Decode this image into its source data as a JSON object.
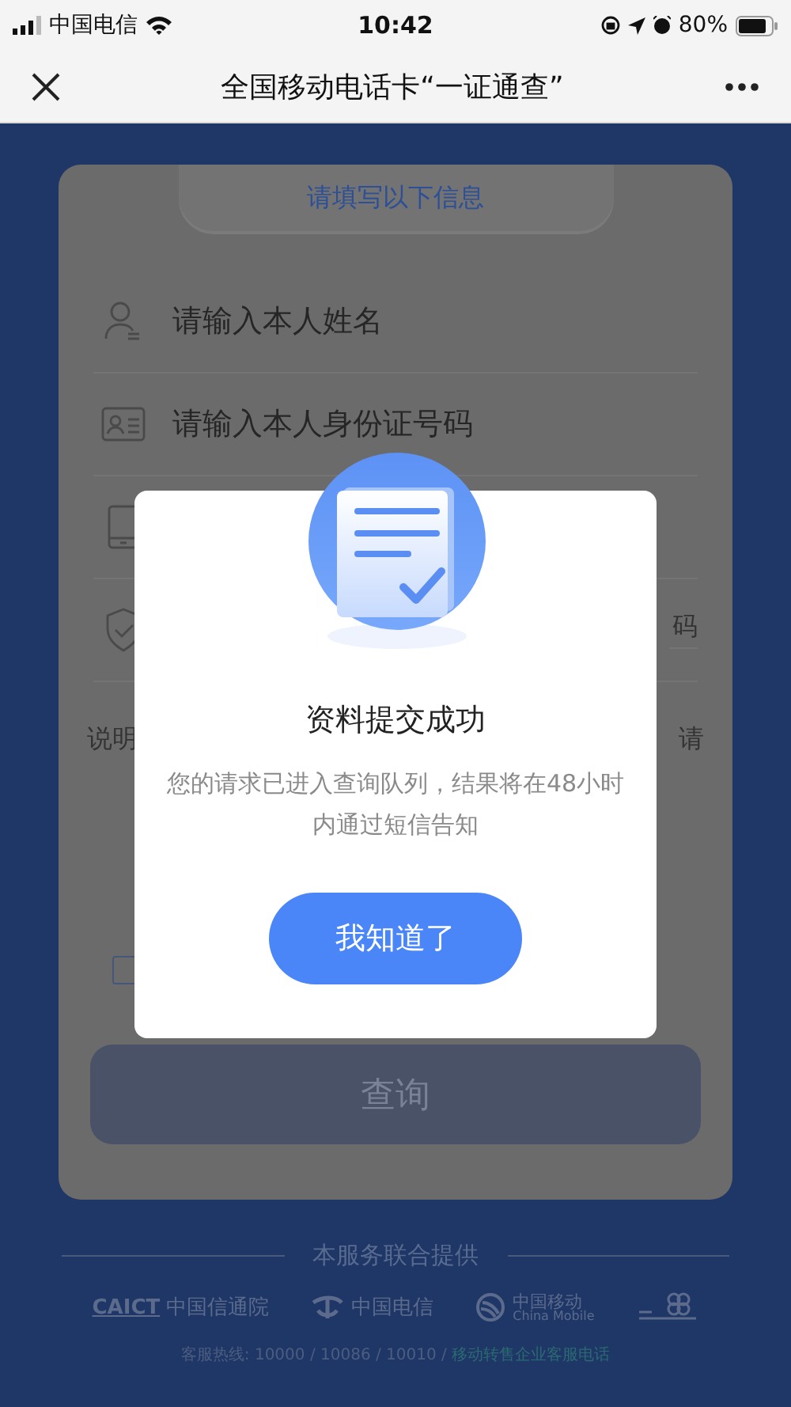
{
  "status_bar": {
    "carrier": "中国电信",
    "time": "10:42",
    "battery": "80%"
  },
  "nav": {
    "title": "全国移动电话卡“一证通查”"
  },
  "form": {
    "header": "请填写以下信息",
    "fields": [
      {
        "kind": "person",
        "placeholder": "请输入本人姓名"
      },
      {
        "kind": "id-card",
        "placeholder": "请输入本人身份证号码"
      },
      {
        "kind": "phone"
      },
      {
        "kind": "shield",
        "text": "码"
      }
    ],
    "note": {
      "left": "说明",
      "right": "请"
    },
    "agree_checked": false,
    "query_button": "查询"
  },
  "footer": {
    "heading": "本服务联合提供",
    "partners": [
      {
        "kind": "caict",
        "name": "CAICT",
        "label": "中国信通院"
      },
      {
        "kind": "telecom",
        "label": "中国电信"
      },
      {
        "kind": "mobile",
        "label": "中国移动",
        "sub": "China Mobile"
      },
      {
        "kind": "unicom"
      }
    ],
    "hotline": "客服热线: 10000 / 10086 / 10010 / ",
    "hotline_link": "移动转售企业客服电话"
  },
  "dialog": {
    "title": "资料提交成功",
    "message": "您的请求已进入查询队列，结果将在48小时内通过短信告知",
    "button": "我知道了"
  }
}
